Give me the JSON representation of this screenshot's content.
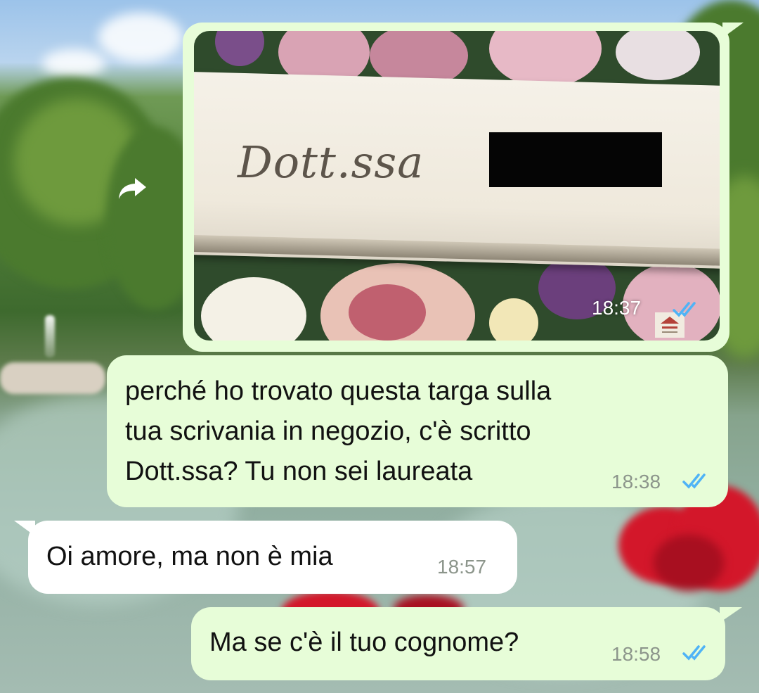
{
  "messages": [
    {
      "direction": "outgoing",
      "type": "image",
      "image_caption_text": "Dott.ssa",
      "time": "18:37",
      "status": "read"
    },
    {
      "direction": "outgoing",
      "type": "text",
      "lines": [
        "perché ho trovato questa targa sulla",
        "tua scrivania in negozio, c'è scritto",
        "Dott.ssa? Tu non sei laureata"
      ],
      "time": "18:38",
      "status": "read"
    },
    {
      "direction": "incoming",
      "type": "text",
      "lines": [
        "Oi amore, ma non è mia"
      ],
      "time": "18:57"
    },
    {
      "direction": "outgoing",
      "type": "text",
      "lines": [
        "Ma se c'è il tuo cognome?"
      ],
      "time": "18:58",
      "status": "read"
    }
  ],
  "icons": {
    "forward": "forward-arrow-icon",
    "read_receipt": "double-check-icon",
    "brand_mark": "plate-brand-logo"
  },
  "colors": {
    "outgoing_bubble": "#e7fdd8",
    "incoming_bubble": "#ffffff",
    "read_tick": "#4fb3f6",
    "timestamp": "#8c958b"
  }
}
